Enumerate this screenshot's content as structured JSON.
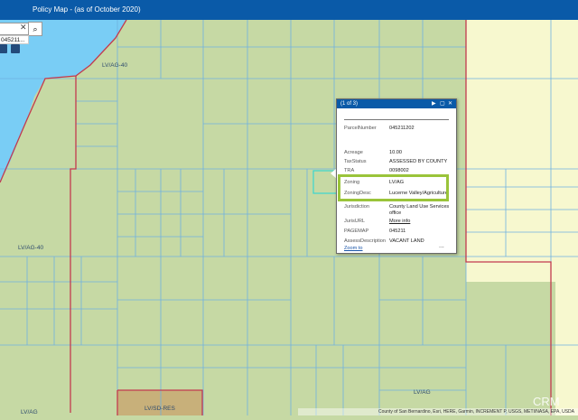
{
  "header": {
    "title": "Policy Map - (as of October 2020)"
  },
  "search": {
    "value": "",
    "clear_icon": "close-icon",
    "button_icon": "search-icon",
    "suggestion": "045211..."
  },
  "colors": {
    "header": "#0a5aa8",
    "water": "#79cdf5",
    "land_green": "#c6d9a4",
    "land_yellow": "#f7f8cf",
    "land_tan": "#c8b07a",
    "parcel_line": "#6fb1e0",
    "zone_boundary": "#c23a4f",
    "highlight": "#9ac43a"
  },
  "map_labels": [
    "LV/AG-40",
    "LV/AG-40",
    "LV/AG",
    "LV/AG",
    "LV/SD-RES"
  ],
  "popup": {
    "counter": "(1 of 3)",
    "next_icon": "play-icon",
    "maximize_icon": "maximize-icon",
    "close_icon": "close-icon",
    "fields": [
      {
        "key": "ParcelNumber",
        "value": "045211202"
      },
      {
        "key": "Acreage",
        "value": "10.00"
      },
      {
        "key": "TaxStatus",
        "value": "ASSESSED BY COUNTY"
      },
      {
        "key": "TRA",
        "value": "0098002"
      },
      {
        "key": "Zoning",
        "value": "LV/AG"
      },
      {
        "key": "ZoningDesc",
        "value": "Lucerne Valley/Agriculture"
      },
      {
        "key": "Jurisdiction",
        "value": "County Land Use Services office"
      },
      {
        "key": "JurisURL",
        "value": "More info"
      },
      {
        "key": "PAGEMAP",
        "value": "045211"
      },
      {
        "key": "AssessDescription",
        "value": "VACANT LAND"
      }
    ],
    "zoom_link": "Zoom to",
    "more": "..."
  },
  "credits": "County of San Bernardino, Esri, HERE, Garmin, INCREMENT P, USGS, METI/NASA, EPA, USDA",
  "watermark": "CRM"
}
